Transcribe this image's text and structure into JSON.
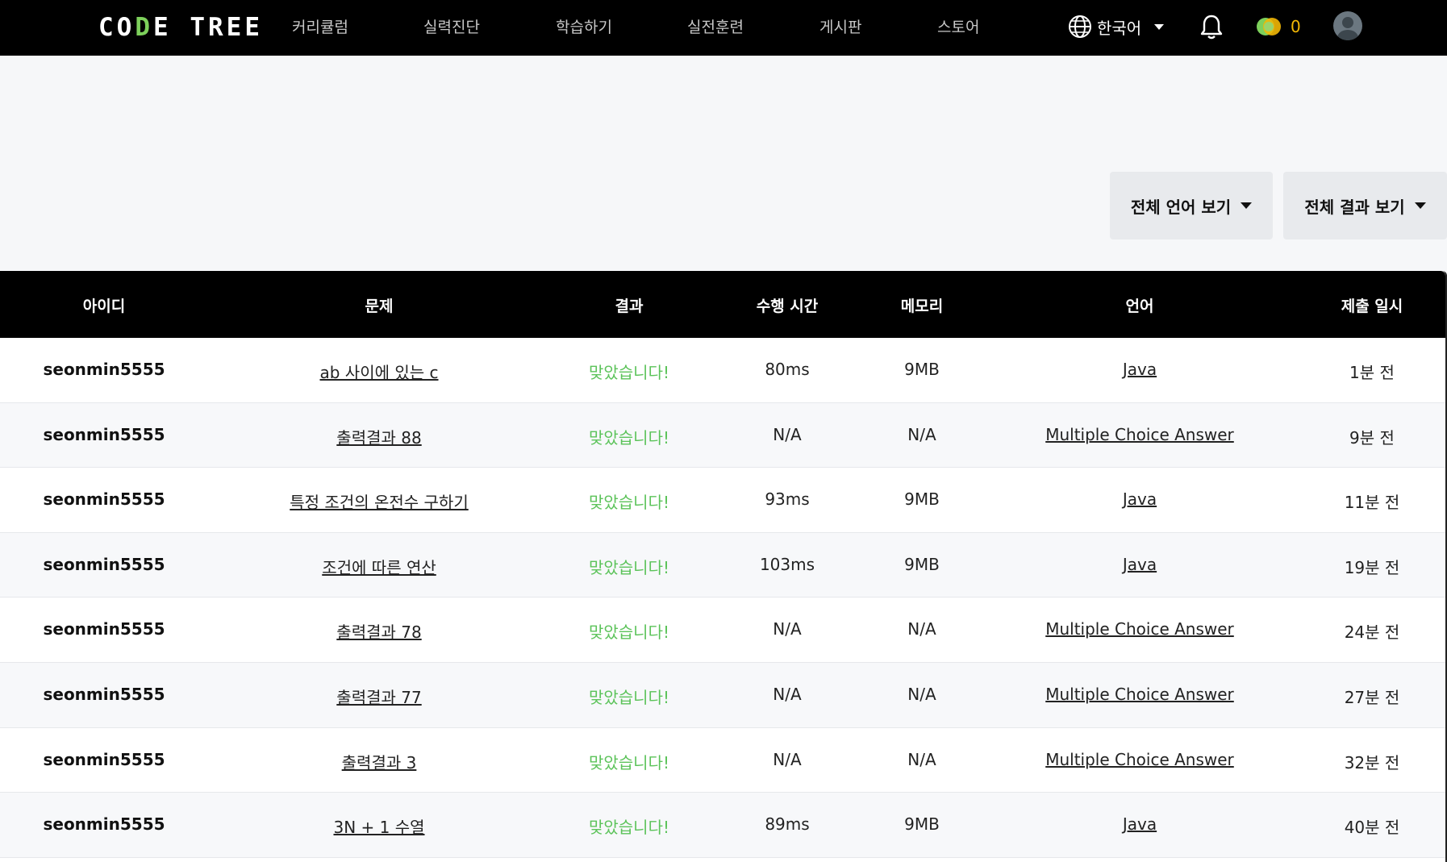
{
  "nav": {
    "logo": {
      "left": "CO",
      "mid": "D",
      "right": "E TREE"
    },
    "items": [
      "커리큘럼",
      "실력진단",
      "학습하기",
      "실전훈련",
      "게시판",
      "스토어"
    ],
    "language": "한국어",
    "coins": "0"
  },
  "filters": {
    "language": "전체 언어 보기",
    "result": "전체 결과 보기"
  },
  "table": {
    "headers": [
      "아이디",
      "문제",
      "결과",
      "수행 시간",
      "메모리",
      "언어",
      "제출 일시"
    ],
    "rows": [
      {
        "user": "seonmin5555",
        "problem": "ab 사이에 있는 c",
        "result": "맞았습니다!",
        "time": "80ms",
        "memory": "9MB",
        "lang": "Java",
        "submitted": "1분 전"
      },
      {
        "user": "seonmin5555",
        "problem": "출력결과 88",
        "result": "맞았습니다!",
        "time": "N/A",
        "memory": "N/A",
        "lang": "Multiple Choice Answer",
        "submitted": "9분 전"
      },
      {
        "user": "seonmin5555",
        "problem": "특정 조건의 온전수 구하기",
        "result": "맞았습니다!",
        "time": "93ms",
        "memory": "9MB",
        "lang": "Java",
        "submitted": "11분 전"
      },
      {
        "user": "seonmin5555",
        "problem": "조건에 따른 연산",
        "result": "맞았습니다!",
        "time": "103ms",
        "memory": "9MB",
        "lang": "Java",
        "submitted": "19분 전"
      },
      {
        "user": "seonmin5555",
        "problem": "출력결과 78",
        "result": "맞았습니다!",
        "time": "N/A",
        "memory": "N/A",
        "lang": "Multiple Choice Answer",
        "submitted": "24분 전"
      },
      {
        "user": "seonmin5555",
        "problem": "출력결과 77",
        "result": "맞았습니다!",
        "time": "N/A",
        "memory": "N/A",
        "lang": "Multiple Choice Answer",
        "submitted": "27분 전"
      },
      {
        "user": "seonmin5555",
        "problem": "출력결과 3",
        "result": "맞았습니다!",
        "time": "N/A",
        "memory": "N/A",
        "lang": "Multiple Choice Answer",
        "submitted": "32분 전"
      },
      {
        "user": "seonmin5555",
        "problem": "3N + 1 수열",
        "result": "맞았습니다!",
        "time": "89ms",
        "memory": "9MB",
        "lang": "Java",
        "submitted": "40분 전"
      }
    ]
  },
  "colors": {
    "accent": "#7dd05b",
    "success": "#5cc35a",
    "coin": "#f2b705"
  },
  "icons": [
    "globe-icon",
    "bell-icon",
    "coin-icon",
    "avatar-icon",
    "chevron-down-icon"
  ]
}
